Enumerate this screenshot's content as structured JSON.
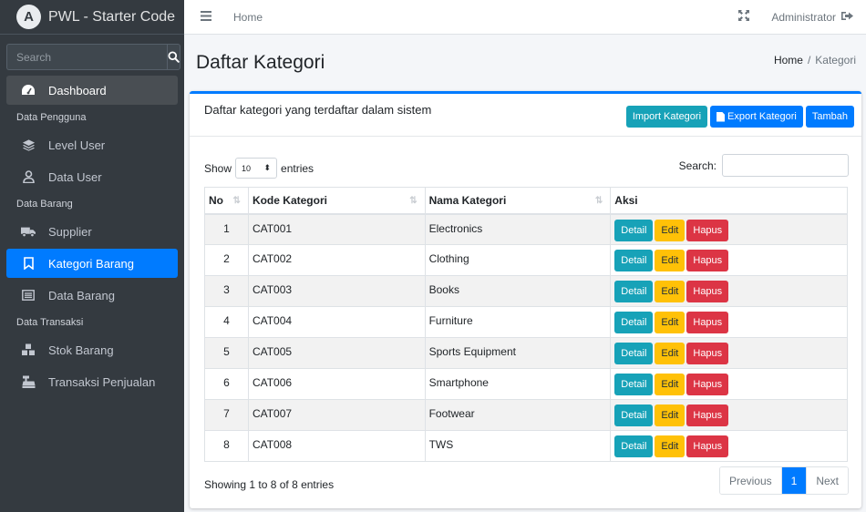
{
  "brand": {
    "title": "PWL - Starter Code",
    "logo_letter": "A"
  },
  "search": {
    "placeholder": "Search"
  },
  "sidebar": {
    "dashboard": "Dashboard",
    "headers": [
      "Data Pengguna",
      "Data Barang",
      "Data Transaksi"
    ],
    "items": [
      {
        "label": "Level User",
        "icon": "layers-icon"
      },
      {
        "label": "Data User",
        "icon": "user-icon"
      },
      {
        "label": "Supplier",
        "icon": "truck-icon"
      },
      {
        "label": "Kategori Barang",
        "icon": "bookmark-icon"
      },
      {
        "label": "Data Barang",
        "icon": "list-icon"
      },
      {
        "label": "Stok Barang",
        "icon": "cubes-icon"
      },
      {
        "label": "Transaksi Penjualan",
        "icon": "cash-register-icon"
      }
    ]
  },
  "topbar": {
    "home": "Home",
    "user": "Administrator"
  },
  "page": {
    "title": "Daftar Kategori",
    "breadcrumb_home": "Home",
    "breadcrumb_current": "Kategori"
  },
  "card": {
    "title": "Daftar kategori yang terdaftar dalam sistem",
    "btn_import": "Import Kategori",
    "btn_export": "Export Kategori",
    "btn_add": "Tambah"
  },
  "controls": {
    "show": "Show",
    "entries_value": "10",
    "entries": "entries",
    "search": "Search:"
  },
  "table": {
    "headers": [
      "No",
      "Kode Kategori",
      "Nama Kategori",
      "Aksi"
    ],
    "rows": [
      {
        "no": "1",
        "kode": "CAT001",
        "nama": "Electronics"
      },
      {
        "no": "2",
        "kode": "CAT002",
        "nama": "Clothing"
      },
      {
        "no": "3",
        "kode": "CAT003",
        "nama": "Books"
      },
      {
        "no": "4",
        "kode": "CAT004",
        "nama": "Furniture"
      },
      {
        "no": "5",
        "kode": "CAT005",
        "nama": "Sports Equipment"
      },
      {
        "no": "6",
        "kode": "CAT006",
        "nama": "Smartphone"
      },
      {
        "no": "7",
        "kode": "CAT007",
        "nama": "Footwear"
      },
      {
        "no": "8",
        "kode": "CAT008",
        "nama": "TWS"
      }
    ],
    "action_detail": "Detail",
    "action_edit": "Edit",
    "action_delete": "Hapus"
  },
  "footer": {
    "info": "Showing 1 to 8 of 8 entries",
    "prev": "Previous",
    "page": "1",
    "next": "Next"
  },
  "colors": {
    "primary": "#007bff",
    "info": "#17a2b8",
    "warning": "#ffc107",
    "danger": "#dc3545",
    "sidebar": "#343a40"
  }
}
